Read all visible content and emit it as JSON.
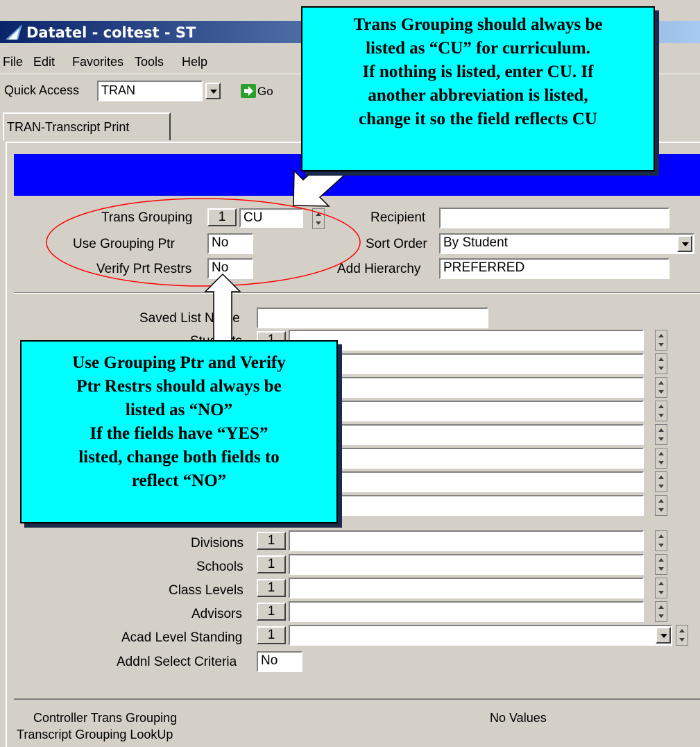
{
  "window": {
    "title": "Datatel - coltest - ST"
  },
  "menu": [
    "File",
    "Edit",
    "Favorites",
    "Tools",
    "Help"
  ],
  "toolbar": {
    "quick_access_label": "Quick Access",
    "quick_access_value": "TRAN",
    "go_label": "Go"
  },
  "tab": {
    "label": "TRAN-Transcript Print"
  },
  "form": {
    "trans_grouping_label": "Trans Grouping",
    "trans_grouping_count": "1",
    "trans_grouping_value": "CU",
    "use_grouping_ptr_label": "Use Grouping Ptr",
    "use_grouping_ptr_value": "No",
    "verify_prt_restrs_label": "Verify Prt Restrs",
    "verify_prt_restrs_value": "No",
    "recipient_label": "Recipient",
    "recipient_value": "",
    "sort_order_label": "Sort Order",
    "sort_order_value": "By Student",
    "add_hierarchy_label": "Add Hierarchy",
    "add_hierarchy_value": "PREFERRED",
    "saved_list_label": "Saved List Name",
    "saved_list_value": "",
    "students_label": "Students",
    "students_count": "1",
    "divisions_label": "Divisions",
    "divisions_count": "1",
    "schools_label": "Schools",
    "schools_count": "1",
    "class_levels_label": "Class Levels",
    "class_levels_count": "1",
    "advisors_label": "Advisors",
    "advisors_count": "1",
    "acad_level_label": "Acad Level Standing",
    "acad_level_count": "1",
    "addnl_label": "Addnl Select Criteria",
    "addnl_value": "No"
  },
  "status": {
    "line1": "Controller Trans Grouping",
    "line2": "Transcript Grouping LookUp",
    "values": "No Values"
  },
  "callouts": {
    "top": [
      "Trans Grouping should always be",
      "listed as “CU” for curriculum.",
      "If nothing is listed, enter CU.  If",
      "another abbreviation is listed,",
      "change it so the field reflects CU"
    ],
    "bottom": [
      "Use Grouping Ptr and Verify",
      "Ptr Restrs should always be",
      "listed as “NO”",
      "If the fields have “YES”",
      "listed, change both fields to",
      "reflect “NO”"
    ]
  },
  "colors": {
    "header_band": "#0000ff",
    "callout": "#00ffff",
    "ellipse": "#ff0000",
    "title_bar": "#0a246a"
  }
}
